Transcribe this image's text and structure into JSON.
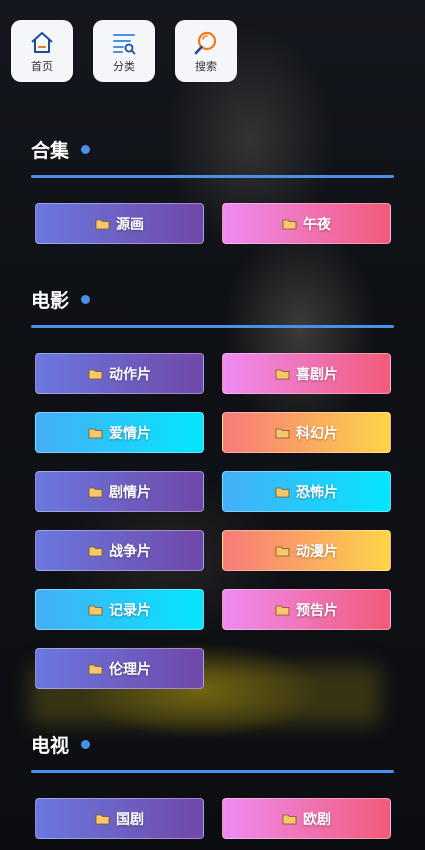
{
  "nav": {
    "home": "首页",
    "category": "分类",
    "search": "搜索"
  },
  "sections": {
    "collection": {
      "title": "合集",
      "items": [
        "源画",
        "午夜"
      ]
    },
    "movie": {
      "title": "电影",
      "items": [
        "动作片",
        "喜剧片",
        "爱情片",
        "科幻片",
        "剧情片",
        "恐怖片",
        "战争片",
        "动漫片",
        "记录片",
        "预告片",
        "伦理片"
      ]
    },
    "tv": {
      "title": "电视",
      "items": [
        "国剧",
        "欧剧"
      ]
    }
  },
  "colors": {
    "accent": "#4a8fe8",
    "purple": [
      "#6b78e0",
      "#7048a8"
    ],
    "pink": [
      "#ee8cf2",
      "#f25a78"
    ],
    "cyan": [
      "#46aef8",
      "#04e6fc"
    ],
    "orange": [
      "#f87a7a",
      "#fdd448"
    ]
  },
  "icons": {
    "home": "home-icon",
    "category": "list-search-icon",
    "search": "magnifier-icon",
    "item": "folder-icon"
  }
}
